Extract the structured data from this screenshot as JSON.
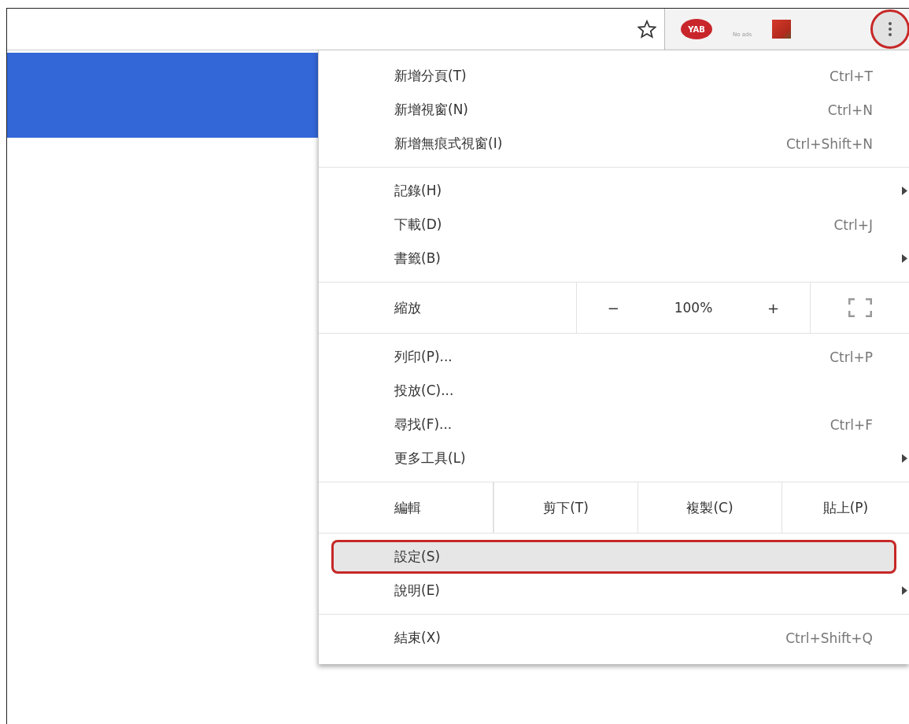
{
  "toolbar": {
    "extensions": [
      {
        "kind": "badge",
        "label": "YAB"
      },
      {
        "kind": "caption",
        "label": "No ads"
      },
      {
        "kind": "tile"
      }
    ],
    "menu_button": {
      "annotated": true
    }
  },
  "menu": {
    "sections": [
      {
        "items": [
          {
            "kind": "item",
            "label": "新增分頁(T)",
            "shortcut": "Ctrl+T",
            "submenu": false,
            "selected": false,
            "annotated": false
          },
          {
            "kind": "item",
            "label": "新增視窗(N)",
            "shortcut": "Ctrl+N",
            "submenu": false,
            "selected": false,
            "annotated": false
          },
          {
            "kind": "item",
            "label": "新增無痕式視窗(I)",
            "shortcut": "Ctrl+Shift+N",
            "submenu": false,
            "selected": false,
            "annotated": false
          }
        ]
      },
      {
        "items": [
          {
            "kind": "item",
            "label": "記錄(H)",
            "submenu": true,
            "selected": false,
            "annotated": false
          },
          {
            "kind": "item",
            "label": "下載(D)",
            "shortcut": "Ctrl+J",
            "submenu": false,
            "selected": false,
            "annotated": false
          },
          {
            "kind": "item",
            "label": "書籤(B)",
            "submenu": true,
            "selected": false,
            "annotated": false
          }
        ]
      },
      {
        "items": [
          {
            "kind": "zoom",
            "label": "縮放",
            "minus": "−",
            "value": "100%",
            "plus": "+"
          }
        ]
      },
      {
        "items": [
          {
            "kind": "item",
            "label": "列印(P)...",
            "shortcut": "Ctrl+P",
            "submenu": false,
            "selected": false,
            "annotated": false
          },
          {
            "kind": "item",
            "label": "投放(C)...",
            "submenu": false,
            "selected": false,
            "annotated": false
          },
          {
            "kind": "item",
            "label": "尋找(F)...",
            "shortcut": "Ctrl+F",
            "submenu": false,
            "selected": false,
            "annotated": false
          },
          {
            "kind": "item",
            "label": "更多工具(L)",
            "submenu": true,
            "selected": false,
            "annotated": false
          }
        ]
      },
      {
        "items": [
          {
            "kind": "edit",
            "label": "編輯",
            "actions": [
              "剪下(T)",
              "複製(C)",
              "貼上(P)"
            ]
          }
        ]
      },
      {
        "items": [
          {
            "kind": "item",
            "label": "設定(S)",
            "submenu": false,
            "selected": true,
            "annotated": true
          },
          {
            "kind": "item",
            "label": "說明(E)",
            "submenu": true,
            "selected": false,
            "annotated": false
          }
        ]
      },
      {
        "items": [
          {
            "kind": "item",
            "label": "結束(X)",
            "shortcut": "Ctrl+Shift+Q",
            "submenu": false,
            "selected": false,
            "annotated": false
          }
        ]
      }
    ]
  }
}
